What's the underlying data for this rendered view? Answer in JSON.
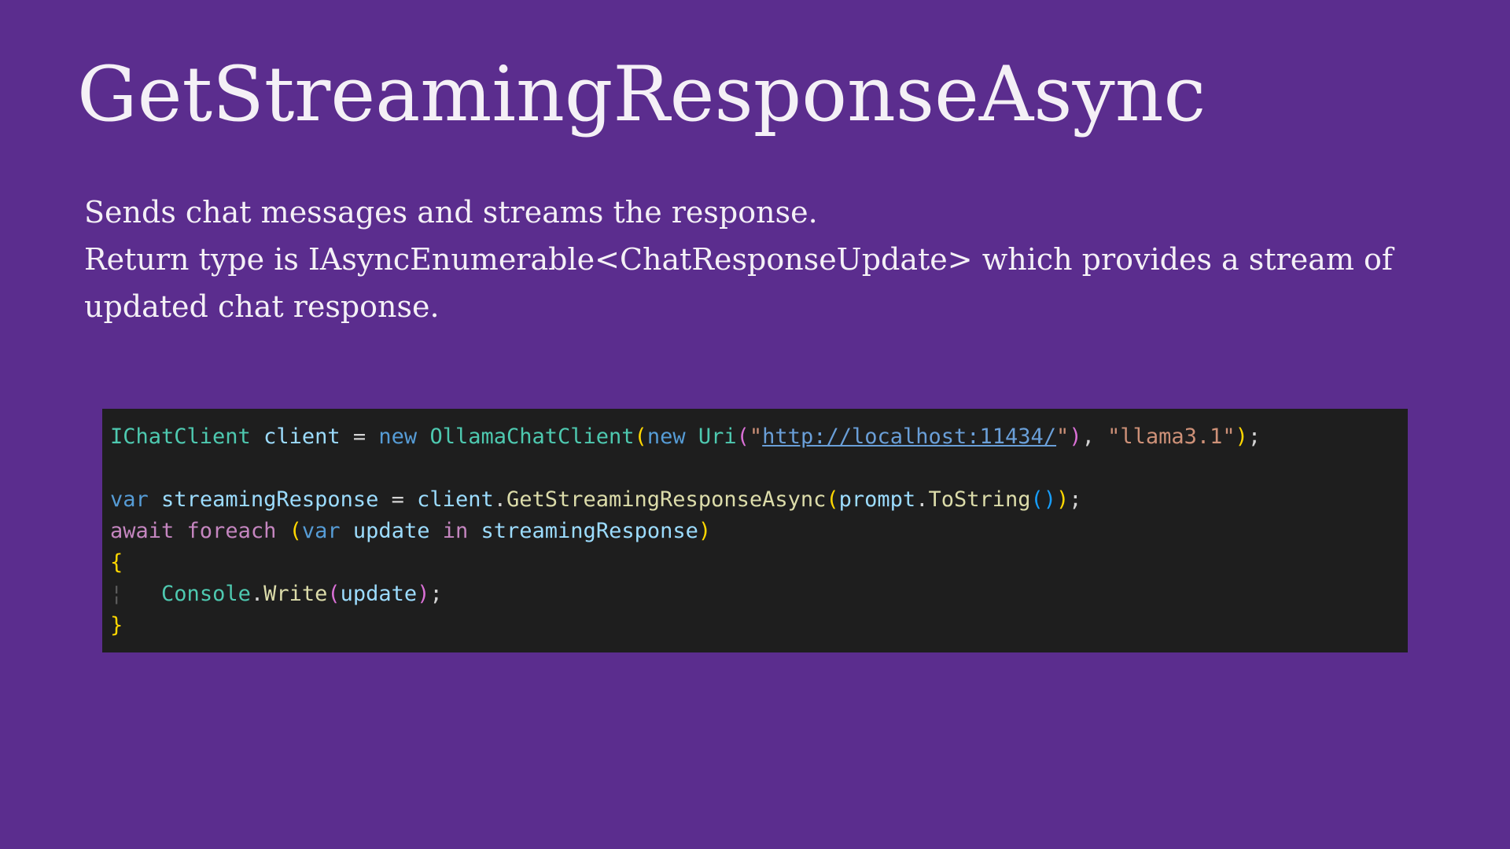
{
  "slide": {
    "title": "GetStreamingResponseAsync",
    "body": [
      "Sends chat messages and streams the response.",
      "Return type is IAsyncEnumerable<ChatResponseUpdate> which provides a stream of updated chat response."
    ]
  },
  "code": {
    "line1": {
      "type1": "IChatClient",
      "var1": "client",
      "op1": " = ",
      "kw1": "new",
      "type2": "OllamaChatClient",
      "paren1": "(",
      "kw2": "new",
      "type3": "Uri",
      "paren2": "(",
      "quote1": "\"",
      "url": "http://localhost:11434/",
      "quote2": "\"",
      "paren2c": ")",
      "comma": ", ",
      "str2": "\"llama3.1\"",
      "paren1c": ")",
      "semi": ";"
    },
    "line2": {
      "kw": "var",
      "var1": "streamingResponse",
      "op1": " = ",
      "var2": "client",
      "dot1": ".",
      "fn1": "GetStreamingResponseAsync",
      "paren1": "(",
      "var3": "prompt",
      "dot2": ".",
      "fn2": "ToString",
      "paren2": "()",
      "paren1c": ")",
      "semi": ";"
    },
    "line3": {
      "ctrl1": "await",
      "ctrl2": "foreach",
      "paren1": "(",
      "kw": "var",
      "var1": "update",
      "ctrl3": "in",
      "var2": "streamingResponse",
      "paren1c": ")"
    },
    "line4": {
      "brace": "{"
    },
    "line5": {
      "guide": "¦",
      "type1": "Console",
      "dot": ".",
      "fn": "Write",
      "paren1": "(",
      "var1": "update",
      "paren1c": ")",
      "semi": ";"
    },
    "line6": {
      "brace": "}"
    }
  },
  "colors": {
    "background": "#5b2d8e",
    "code_background": "#1e1e1e",
    "text": "#f4f0f6"
  }
}
